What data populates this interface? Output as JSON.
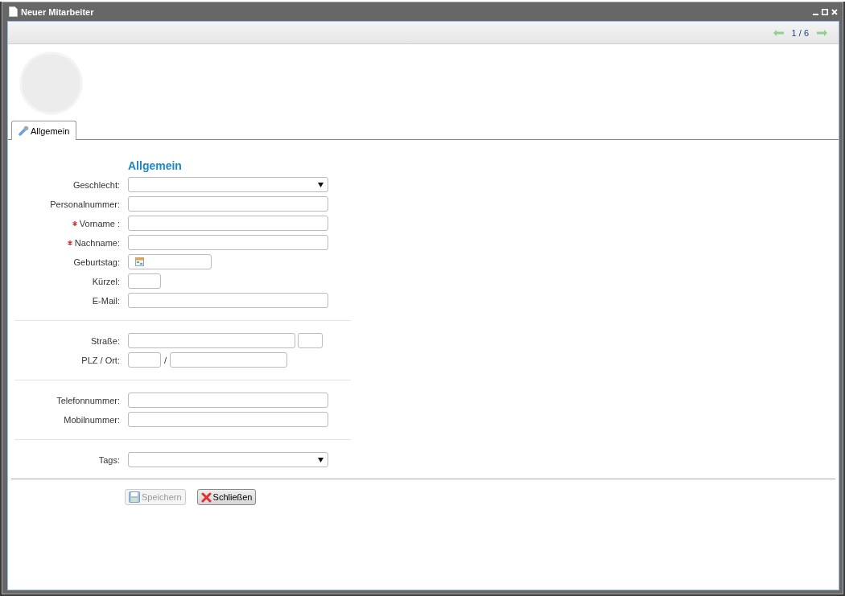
{
  "window": {
    "title": "Neuer Mitarbeiter"
  },
  "pager": {
    "text": "1 / 6"
  },
  "tabs": [
    {
      "label": "Allgemein",
      "selected": true
    }
  ],
  "form": {
    "heading": "Allgemein",
    "sections": [
      {
        "rows": [
          {
            "label": "Geschlecht:",
            "required": false,
            "fields": [
              {
                "kind": "select"
              }
            ]
          },
          {
            "label": "Personalnummer:",
            "required": false,
            "fields": [
              {
                "kind": "text"
              }
            ]
          },
          {
            "label": "Vorname :",
            "required": true,
            "fields": [
              {
                "kind": "text"
              }
            ]
          },
          {
            "label": "Nachname:",
            "required": true,
            "fields": [
              {
                "kind": "text"
              }
            ]
          },
          {
            "label": "Geburtstag:",
            "required": false,
            "fields": [
              {
                "kind": "date"
              }
            ]
          },
          {
            "label": "Kürzel:",
            "required": false,
            "fields": [
              {
                "kind": "short"
              }
            ]
          },
          {
            "label": "E-Mail:",
            "required": false,
            "fields": [
              {
                "kind": "text"
              }
            ]
          }
        ]
      },
      {
        "rows": [
          {
            "label": "Straße:",
            "required": false,
            "fields": [
              {
                "kind": "street"
              },
              {
                "kind": "housenumber"
              }
            ]
          },
          {
            "label": "PLZ / Ort:",
            "required": false,
            "fields": [
              {
                "kind": "short"
              },
              {
                "kind": "slash",
                "text": "/"
              },
              {
                "kind": "city"
              }
            ]
          }
        ]
      },
      {
        "rows": [
          {
            "label": "Telefonnummer:",
            "required": false,
            "fields": [
              {
                "kind": "text"
              }
            ]
          },
          {
            "label": "Mobilnummer:",
            "required": false,
            "fields": [
              {
                "kind": "text"
              }
            ]
          }
        ]
      },
      {
        "rows": [
          {
            "label": "Tags:",
            "required": false,
            "fields": [
              {
                "kind": "select"
              }
            ]
          }
        ]
      }
    ]
  },
  "buttons": [
    {
      "label": "Speichern",
      "kind": "save",
      "disabled": true
    },
    {
      "label": "Schließen",
      "kind": "close",
      "disabled": false
    }
  ]
}
